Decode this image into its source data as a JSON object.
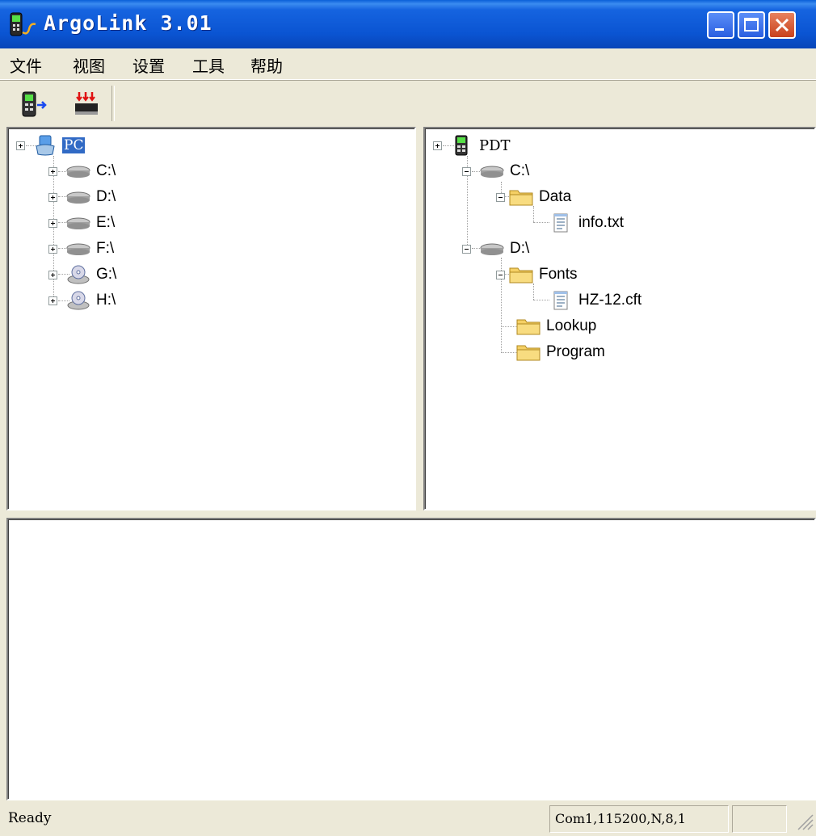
{
  "window": {
    "title": "ArgoLink 3.01"
  },
  "menu": {
    "items": [
      "文件",
      "视图",
      "设置",
      "工具",
      "帮助"
    ]
  },
  "toolbar": {
    "buttons": [
      "pdt-transfer-icon",
      "memory-chip-icon"
    ]
  },
  "left_tree": {
    "root": "PC",
    "drives": [
      "C:\\",
      "D:\\",
      "E:\\",
      "F:\\",
      "G:\\",
      "H:\\"
    ]
  },
  "right_tree": {
    "root": "PDT",
    "c_drive": "C:\\",
    "c_folder": "Data",
    "c_file": "info.txt",
    "d_drive": "D:\\",
    "d_folder_fonts": "Fonts",
    "d_file": "HZ-12.cft",
    "d_folder_lookup": "Lookup",
    "d_folder_program": "Program"
  },
  "status": {
    "text": "Ready",
    "port": "Com1,115200,N,8,1"
  },
  "colors": {
    "title_blue": "#0a54d2",
    "selection": "#316ac5",
    "folder": "#f5d065",
    "close_red": "#c8401c"
  }
}
